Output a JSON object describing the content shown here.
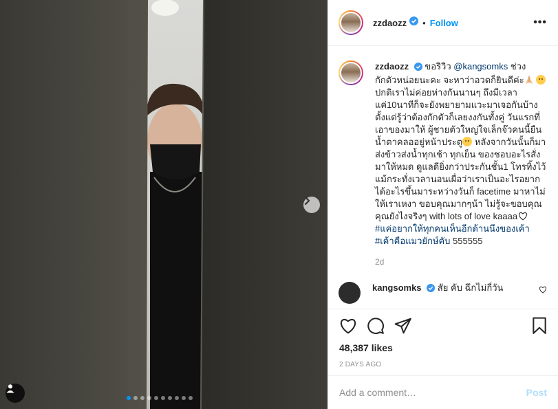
{
  "post": {
    "username": "zzdaozz",
    "follow_label": "Follow",
    "separator": "•",
    "more_label": "•••",
    "carousel": {
      "count": 10,
      "active_index": 0
    }
  },
  "caption": {
    "username": "zzdaozz",
    "text_parts": {
      "p1": "ขอริวิว ",
      "mention": "@kangsomks",
      "p2": " ช่วงกักตัวหน่อยนะคะ จะหาว่าอวดก็ยินดีค่ะ",
      "p3": " ปกติเราไม่ค่อยห่างกันนานๆ ถึงมีเวลาแค่10นาทีก็จะยังพยายามแวะมาเจอกันบ้าง ตั้งแต่รู้ว่าต้องกักตัวก็เลยงงกันทั้งคู่ วันแรกที่เอาของมาให้ ผู้ชายตัวใหญ่ใจเล็กจ๊วคนนี้ยืนน้ำตาคลออยู่หน้าประตู",
      "p4": " หลังจากวันนั้นก็มาส่งข้าวส่งน้ำทุกเช้า ทุกเย็น ของชอบอะไรสั่งมาให้หมด ดูแลดียิ่งกว่าประกันชั้น1 โทรทิ้งไว้แม้กระทั่งเวลานอนเผื่อว่าเราเป็นอะไรอยากได้อะไรขึ้นมาระหว่างวันก็ facetime มาหาไม่ให้เราเหงา ขอบคุณมากๆน้า ไม่รู้จะขอบคุณคุณยังไงจริงๆ with lots of love kaaaa",
      "tags": "#แค่อยากให้ทุกคนเห็นอีกด้านนึงของเค้า #เค้าคือแมวยักษ์คับ",
      "p5": " 555555"
    },
    "time_ago": "2d"
  },
  "comment": {
    "username": "kangsomks",
    "text": " สัย คับ ฉึกไม่กี่วัน"
  },
  "actions": {
    "likes": "48,387 likes",
    "date": "2 DAYS AGO"
  },
  "comment_box": {
    "placeholder": "Add a comment…",
    "post_label": "Post"
  },
  "icons": [
    "heart-icon",
    "comment-icon",
    "share-icon",
    "bookmark-icon",
    "verified-icon",
    "chevron-right-icon",
    "user-tag-icon",
    "more-icon"
  ],
  "colors": {
    "accent": "#0095f6",
    "link": "#00376b",
    "muted": "#8e8e8e",
    "post_disabled": "#b2dffc"
  }
}
